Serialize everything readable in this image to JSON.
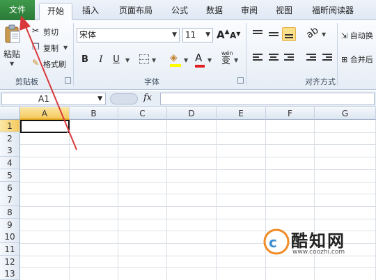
{
  "tabs": {
    "file": "文件",
    "home": "开始",
    "insert": "插入",
    "page_layout": "页面布局",
    "formulas": "公式",
    "data": "数据",
    "review": "审阅",
    "view": "视图",
    "foxit": "福昕阅读器"
  },
  "clipboard": {
    "paste": "粘贴",
    "cut": "剪切",
    "copy": "复制",
    "format_painter": "格式刷",
    "group_label": "剪贴板"
  },
  "font": {
    "name": "宋体",
    "size": "11",
    "bold": "B",
    "italic": "I",
    "underline": "U",
    "phonetic": "wén",
    "phonetic_char": "变",
    "font_color_letter": "A",
    "grow_letter": "A",
    "shrink_letter": "A",
    "group_label": "字体"
  },
  "alignment": {
    "wrap_text": "自动换",
    "merge_center": "合并后",
    "group_label": "对齐方式"
  },
  "formula_bar": {
    "name_box": "A1",
    "fx": "fx",
    "value": ""
  },
  "grid": {
    "columns": [
      "A",
      "B",
      "C",
      "D",
      "E",
      "F",
      "G"
    ],
    "rows": [
      "1",
      "2",
      "3",
      "4",
      "5",
      "6",
      "7",
      "8",
      "9",
      "10",
      "11",
      "12",
      "13"
    ],
    "active_cell": "A1"
  },
  "watermark": {
    "title": "酷知网",
    "url": "www.coozhi.com"
  },
  "colors": {
    "file_tab": "#2a7a37",
    "arrow": "#d9383a",
    "selected_header": "#f4c95c"
  }
}
